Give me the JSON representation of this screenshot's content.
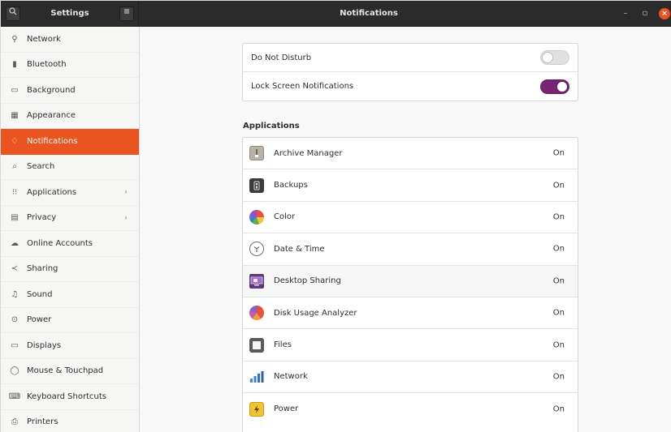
{
  "header": {
    "left_title": "Settings",
    "main_title": "Notifications",
    "search_icon": "search-icon",
    "menu_icon": "hamburger-icon",
    "minimize_glyph": "–",
    "maximize_glyph": "▫",
    "close_glyph": "×"
  },
  "sidebar": {
    "items": [
      {
        "label": "Network",
        "icon": "network-icon",
        "glyph": "⚲"
      },
      {
        "label": "Bluetooth",
        "icon": "bluetooth-icon",
        "glyph": "▮"
      },
      {
        "label": "Background",
        "icon": "background-icon",
        "glyph": "▭"
      },
      {
        "label": "Appearance",
        "icon": "appearance-icon",
        "glyph": "▦"
      },
      {
        "label": "Notifications",
        "icon": "bell-icon",
        "glyph": "♢"
      },
      {
        "label": "Search",
        "icon": "search-icon",
        "glyph": "⌕"
      },
      {
        "label": "Applications",
        "icon": "grid-icon",
        "glyph": "⁝⁝",
        "chevron": "›"
      },
      {
        "label": "Privacy",
        "icon": "hand-icon",
        "glyph": "▤",
        "chevron": "›"
      },
      {
        "label": "Online Accounts",
        "icon": "cloud-icon",
        "glyph": "☁"
      },
      {
        "label": "Sharing",
        "icon": "share-icon",
        "glyph": "≺"
      },
      {
        "label": "Sound",
        "icon": "music-note-icon",
        "glyph": "♫"
      },
      {
        "label": "Power",
        "icon": "power-icon",
        "glyph": "⊙"
      },
      {
        "label": "Displays",
        "icon": "display-icon",
        "glyph": "▭"
      },
      {
        "label": "Mouse & Touchpad",
        "icon": "mouse-icon",
        "glyph": "◯"
      },
      {
        "label": "Keyboard Shortcuts",
        "icon": "keyboard-icon",
        "glyph": "⌨"
      },
      {
        "label": "Printers",
        "icon": "printer-icon",
        "glyph": "⎙"
      }
    ],
    "active_index": 4
  },
  "main": {
    "toggles": [
      {
        "label": "Do Not Disturb",
        "state": "off"
      },
      {
        "label": "Lock Screen Notifications",
        "state": "on"
      }
    ],
    "applications_title": "Applications",
    "applications": [
      {
        "name": "Archive Manager",
        "status": "On",
        "icon": "archive-manager-icon"
      },
      {
        "name": "Backups",
        "status": "On",
        "icon": "backups-icon"
      },
      {
        "name": "Color",
        "status": "On",
        "icon": "color-icon"
      },
      {
        "name": "Date & Time",
        "status": "On",
        "icon": "clock-icon"
      },
      {
        "name": "Desktop Sharing",
        "status": "On",
        "icon": "desktop-sharing-icon"
      },
      {
        "name": "Disk Usage Analyzer",
        "status": "On",
        "icon": "disk-usage-icon"
      },
      {
        "name": "Files",
        "status": "On",
        "icon": "files-icon"
      },
      {
        "name": "Network",
        "status": "On",
        "icon": "network-signal-icon"
      },
      {
        "name": "Power",
        "status": "On",
        "icon": "power-bolt-icon"
      }
    ]
  },
  "colors": {
    "accent": "#e95420",
    "toggle_on": "#762572",
    "headerbar": "#2b2b2b"
  }
}
